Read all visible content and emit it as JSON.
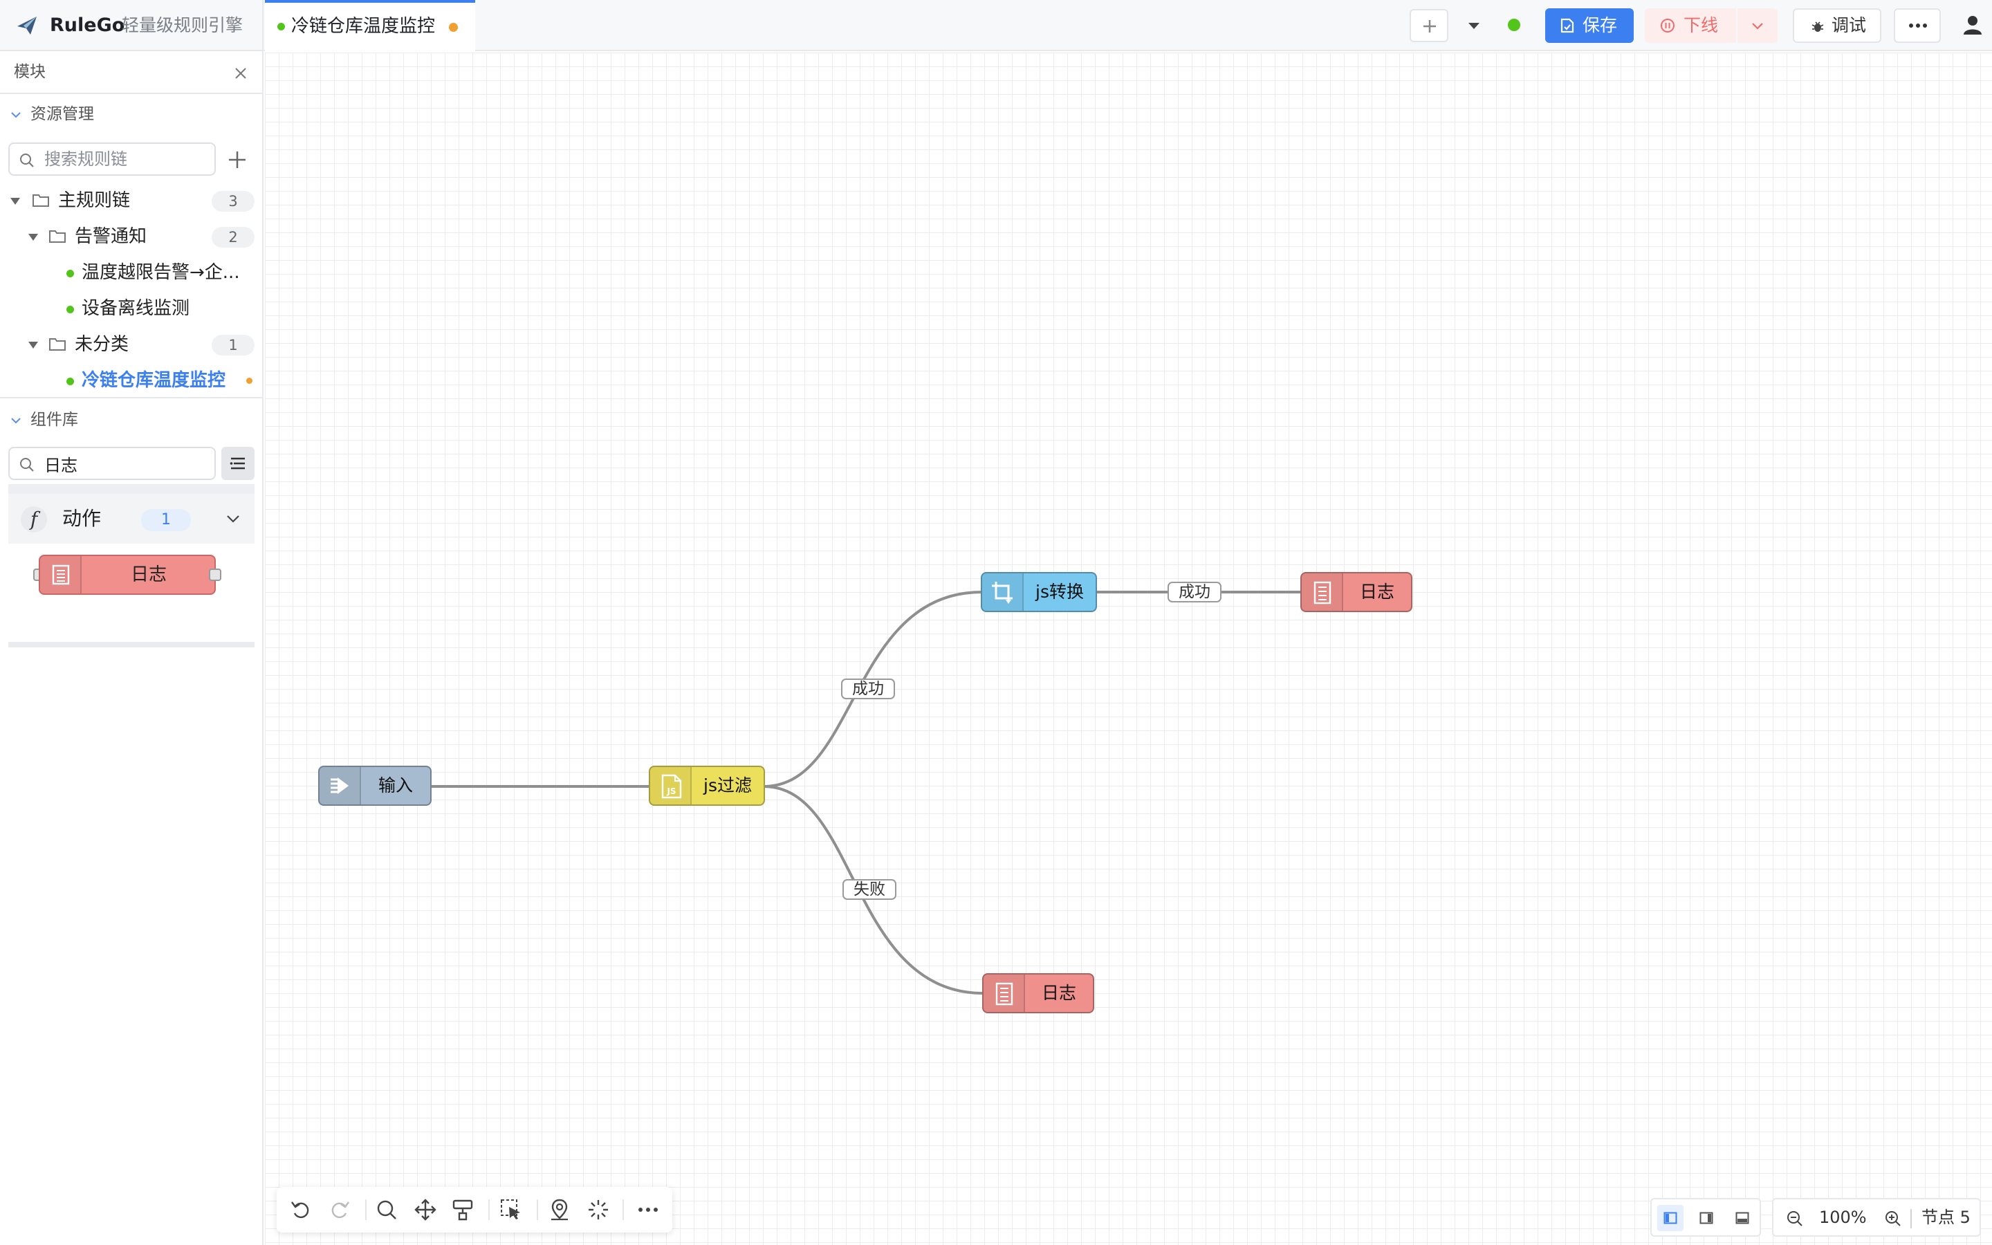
{
  "app": {
    "name": "RuleGo",
    "subtitle": "轻量级规则引擎"
  },
  "tab": {
    "title": "冷链仓库温度监控"
  },
  "toolbar": {
    "save_label": "保存",
    "offline_label": "下线",
    "debug_label": "调试"
  },
  "sidebar": {
    "title": "模块",
    "resources": {
      "label": "资源管理",
      "search_placeholder": "搜索规则链",
      "tree": {
        "main_folder": {
          "label": "主规则链",
          "count": "3"
        },
        "alert_folder": {
          "label": "告警通知",
          "count": "2"
        },
        "alert_items": [
          "温度越限告警→企...",
          "设备离线监测"
        ],
        "uncategorized_folder": {
          "label": "未分类",
          "count": "1"
        },
        "active_item": "冷链仓库温度监控"
      }
    },
    "components": {
      "label": "组件库",
      "search_value": "日志",
      "category": {
        "icon": "function-icon",
        "label": "动作",
        "count": "1"
      },
      "palette_node": "日志"
    }
  },
  "canvas": {
    "nodes": {
      "input": "输入",
      "filter": "js过滤",
      "transform": "js转换",
      "log_success": "日志",
      "log_failure": "日志"
    },
    "edges": {
      "filter_success": "成功",
      "filter_failure": "失败",
      "transform_success": "成功"
    }
  },
  "status": {
    "zoom": "100%",
    "node_count": "节点 5"
  },
  "colors": {
    "accent": "#3b7ff0",
    "status_ok": "#52c41a",
    "modified": "#f0a030",
    "offline_text": "#f26b6b",
    "node_input": "#a6bbcf",
    "node_filter": "#ecdf5c",
    "node_transform": "#79c8ef",
    "node_log": "#f0908d"
  }
}
